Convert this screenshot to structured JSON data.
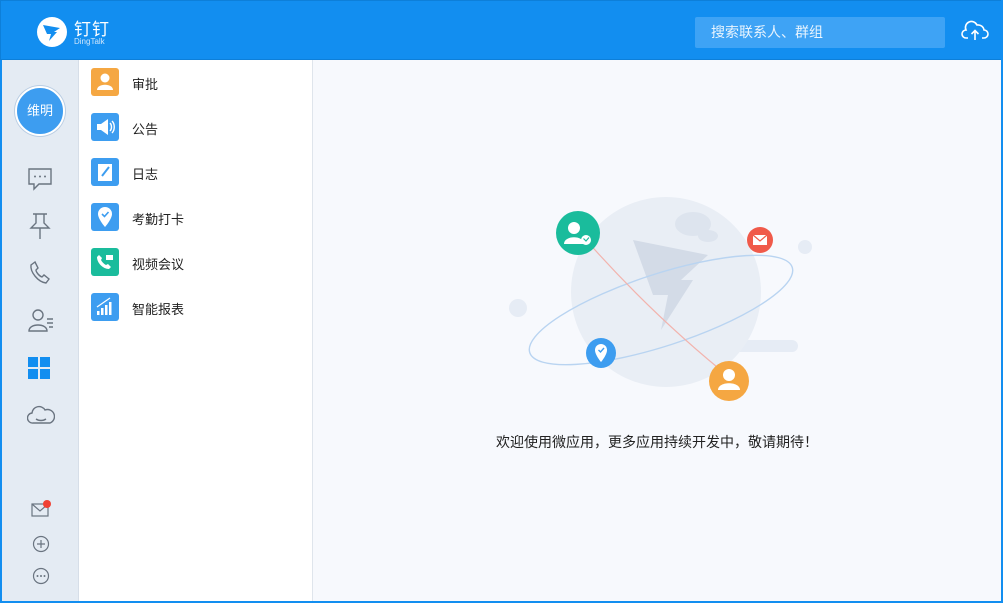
{
  "header": {
    "brand_name": "钉钉",
    "brand_en": "DingTalk",
    "search_placeholder": "搜索联系人、群组"
  },
  "user": {
    "avatar_text": "维明"
  },
  "leftnav": {
    "icons": [
      "message-icon",
      "pin-icon",
      "phone-icon",
      "contacts-icon",
      "apps-grid-icon",
      "cloud-icon",
      "mail-icon",
      "add-icon",
      "more-icon"
    ],
    "active": "apps-grid-icon",
    "notification": true
  },
  "apps": [
    {
      "label": "审批",
      "icon": "approval-icon",
      "color": "#f5a742"
    },
    {
      "label": "公告",
      "icon": "announcement-icon",
      "color": "#3d9df0"
    },
    {
      "label": "日志",
      "icon": "log-icon",
      "color": "#3d9df0"
    },
    {
      "label": "考勤打卡",
      "icon": "attendance-icon",
      "color": "#3d9df0"
    },
    {
      "label": "视频会议",
      "icon": "video-meeting-icon",
      "color": "#1abc9c"
    },
    {
      "label": "智能报表",
      "icon": "report-icon",
      "color": "#3d9df0"
    }
  ],
  "main": {
    "welcome_text": "欢迎使用微应用，更多应用持续开发中，敬请期待！"
  },
  "colors": {
    "brand": "#128ef0",
    "nav_bg": "#e4ebf3",
    "accent_orange": "#f5a742",
    "accent_green": "#1abc9c",
    "accent_red": "#f05a4a"
  }
}
